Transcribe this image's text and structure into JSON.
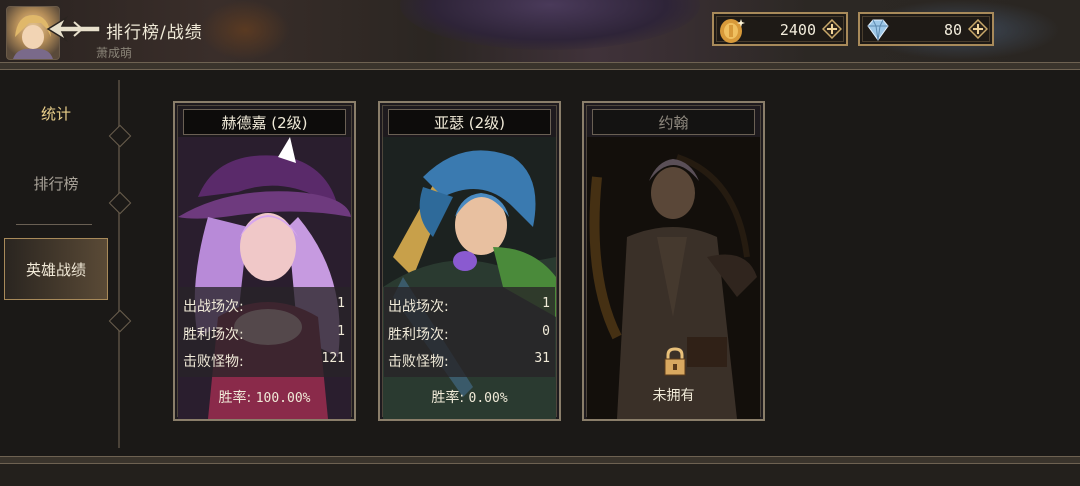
{
  "header": {
    "title": "排行榜/战绩",
    "player_name": "萧成萌",
    "gold": "2400",
    "gems": "80"
  },
  "sidebar": {
    "items": [
      {
        "label": "统计"
      },
      {
        "label": "排行榜"
      },
      {
        "label": "英雄战绩"
      }
    ],
    "active_index": 2
  },
  "heroes": [
    {
      "name": "赫德嘉 (2级)",
      "sorties_label": "出战场次:",
      "sorties": "1",
      "wins_label": "胜利场次:",
      "wins": "1",
      "kills_label": "击败怪物:",
      "kills": "121",
      "winrate_label": "胜率:",
      "winrate": "100.00%",
      "owned": true
    },
    {
      "name": "亚瑟 (2级)",
      "sorties_label": "出战场次:",
      "sorties": "1",
      "wins_label": "胜利场次:",
      "wins": "0",
      "kills_label": "击败怪物:",
      "kills": "31",
      "winrate_label": "胜率:",
      "winrate": "0.00%",
      "owned": true
    },
    {
      "name": "约翰",
      "owned": false,
      "locked_label": "未拥有"
    }
  ],
  "colors": {
    "accent_gold": "#e9cf8a",
    "frame": "#8a7e6a",
    "active_tab": "#5a4a36"
  },
  "icons": [
    "back-arrow-icon",
    "gold-coin-icon",
    "diamond-icon",
    "plus-icon",
    "lock-icon"
  ]
}
